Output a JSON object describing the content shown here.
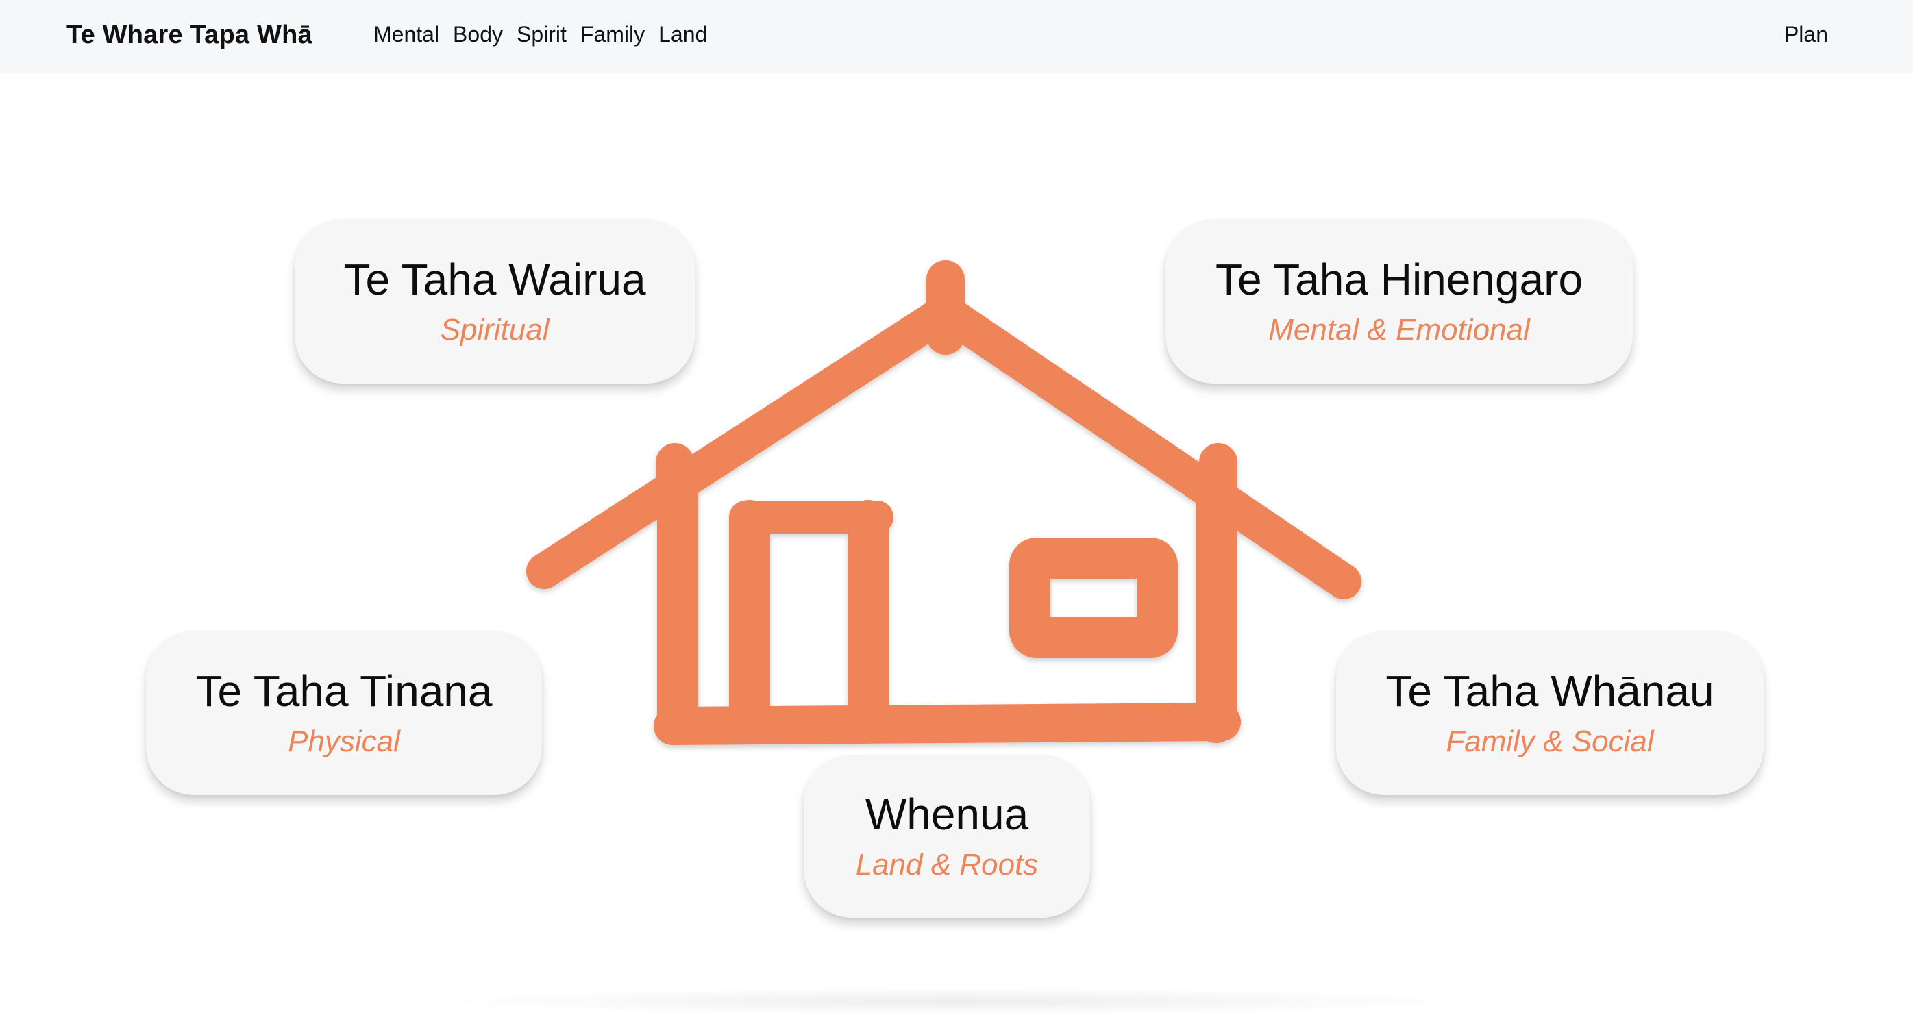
{
  "nav": {
    "brand": "Te Whare Tapa Whā",
    "links": [
      "Mental",
      "Body",
      "Spirit",
      "Family",
      "Land"
    ],
    "plan": "Plan"
  },
  "colors": {
    "accent": "#ef8458",
    "card_bg": "#f6f6f7",
    "nav_bg": "#f6f7f9"
  },
  "house": {
    "icon": "wharenui-house-icon"
  },
  "cards": {
    "wairua": {
      "title": "Te Taha Wairua",
      "subtitle": "Spiritual"
    },
    "hinengaro": {
      "title": "Te Taha Hinengaro",
      "subtitle": "Mental & Emotional"
    },
    "tinana": {
      "title": "Te Taha Tinana",
      "subtitle": "Physical"
    },
    "whanau": {
      "title": "Te Taha Whānau",
      "subtitle": "Family & Social"
    },
    "whenua": {
      "title": "Whenua",
      "subtitle": "Land & Roots"
    }
  }
}
